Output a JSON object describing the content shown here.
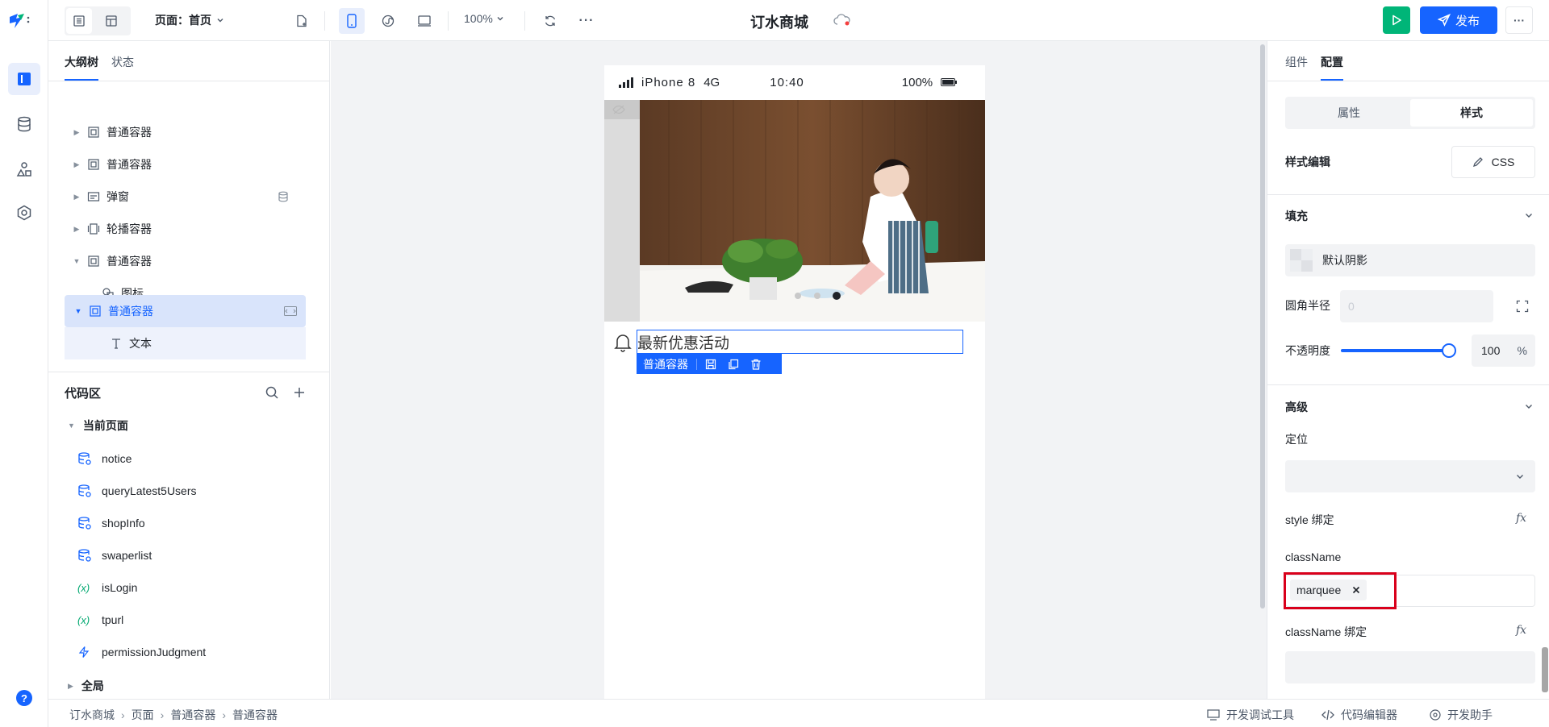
{
  "app": {
    "title": "订水商城"
  },
  "rail": {
    "help_label": "?"
  },
  "topbar": {
    "page_label": "页面：首页",
    "zoom": "100%",
    "more": "···",
    "publish_label": "发布"
  },
  "left": {
    "tabs": [
      "大纲树",
      "状态"
    ],
    "tree": [
      {
        "label": "普通容器",
        "icon": "container-icon"
      },
      {
        "label": "普通容器",
        "icon": "container-icon"
      },
      {
        "label": "弹窗",
        "icon": "dialog-icon"
      },
      {
        "label": "轮播容器",
        "icon": "carousel-icon"
      },
      {
        "label": "普通容器",
        "icon": "container-icon"
      },
      {
        "label": "图标",
        "icon": "shapes-icon"
      },
      {
        "label": "普通容器",
        "icon": "container-icon"
      },
      {
        "label": "文本",
        "icon": "text-icon"
      }
    ],
    "code_area": {
      "title": "代码区",
      "current_page": "当前页面",
      "items": [
        {
          "label": "notice",
          "type": "datasource"
        },
        {
          "label": "queryLatest5Users",
          "type": "datasource"
        },
        {
          "label": "shopInfo",
          "type": "datasource"
        },
        {
          "label": "swaperlist",
          "type": "datasource"
        },
        {
          "label": "isLogin",
          "type": "variable"
        },
        {
          "label": "tpurl",
          "type": "variable"
        },
        {
          "label": "permissionJudgment",
          "type": "function"
        }
      ],
      "global": "全局"
    }
  },
  "phone": {
    "device": "iPhone 8",
    "network": "4G",
    "time": "10:40",
    "battery": "100%",
    "notice_text": "最新优惠活动",
    "selected_tag": "普通容器",
    "carousel_active_dot": 2
  },
  "right": {
    "tabs": [
      "组件",
      "配置"
    ],
    "segment": [
      "属性",
      "样式"
    ],
    "style_edit": "样式编辑",
    "css_button": "CSS",
    "fill_section": "填充",
    "fill_value": "默认阴影",
    "radius_label": "圆角半径",
    "radius_placeholder": "0",
    "opacity_label": "不透明度",
    "opacity_value": "100",
    "opacity_unit": "%",
    "opacity_fraction": 1.0,
    "advanced_section": "高级",
    "position_label": "定位",
    "style_binding_label": "style 绑定",
    "fx": "fx",
    "classname_label": "className",
    "classname_tag": "marquee",
    "classname_binding_label": "className 绑定",
    "highlight_color": "#d9001b"
  },
  "bottom": {
    "breadcrumb": [
      "订水商城",
      "页面",
      "普通容器",
      "普通容器"
    ],
    "dev_tools": "开发调试工具",
    "code_editor": "代码编辑器",
    "dev_assistant": "开发助手"
  },
  "colors": {
    "accent": "#1664ff",
    "run": "#00b578"
  }
}
